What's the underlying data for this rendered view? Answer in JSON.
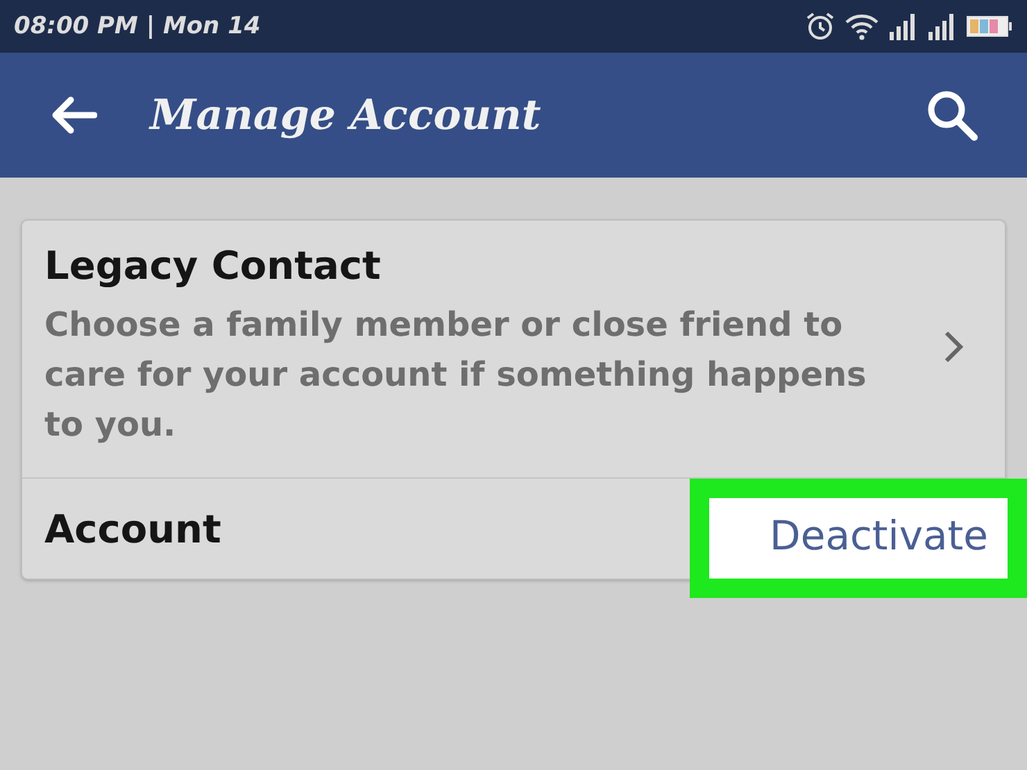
{
  "status_bar": {
    "time": "08:00 PM | Mon 14"
  },
  "app_bar": {
    "title": "Manage Account"
  },
  "settings": [
    {
      "kind": "link",
      "title": "Legacy Contact",
      "description": "Choose a family member or close friend to care for your account if something happens to you."
    },
    {
      "kind": "action",
      "title": "Account",
      "action": "Deactivate",
      "highlighted": true
    }
  ]
}
